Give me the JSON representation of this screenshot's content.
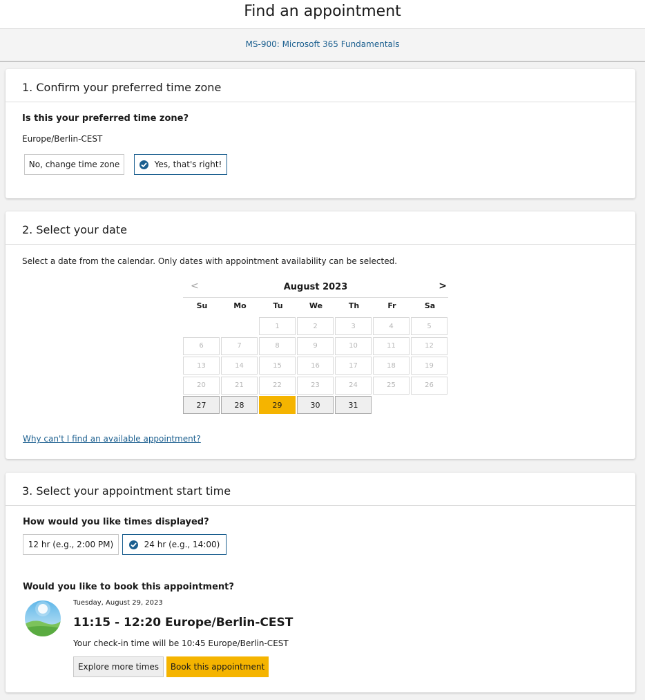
{
  "header": {
    "title": "Find an appointment"
  },
  "exam": {
    "link": "MS-900: Microsoft 365 Fundamentals"
  },
  "section1": {
    "title": "1. Confirm your preferred time zone",
    "question": "Is this your preferred time zone?",
    "timezone": "Europe/Berlin-CEST",
    "change_button": "No, change time zone",
    "confirm_button": "Yes, that's right!"
  },
  "section2": {
    "title": "2. Select your date",
    "instructions": "Select a date from the calendar. Only dates with appointment availability can be selected.",
    "calendar": {
      "month": "August 2023",
      "prev": "<",
      "next": ">",
      "weekdays": [
        "Su",
        "Mo",
        "Tu",
        "We",
        "Th",
        "Fr",
        "Sa"
      ],
      "first_weekday_index": 2,
      "days_in_month": 31,
      "available_days": [
        27,
        28,
        29,
        30,
        31
      ],
      "selected_day": 29
    },
    "help_link": "Why can't I find an available appointment?"
  },
  "section3": {
    "title": "3. Select your appointment start time",
    "format_question": "How would you like times displayed?",
    "format_12": "12 hr (e.g., 2:00 PM)",
    "format_24": "24 hr (e.g., 14:00)",
    "selected_format": "24",
    "book_question": "Would you like to book this appointment?",
    "appointment": {
      "date": "Tuesday, August 29, 2023",
      "time": "11:15 - 12:20 Europe/Berlin-CEST",
      "checkin": "Your check-in time will be 10:45 Europe/Berlin-CEST"
    },
    "explore_button": "Explore more times",
    "book_button": "Book this appointment"
  },
  "colors": {
    "accent": "#1b5f8f",
    "highlight": "#f5b400"
  }
}
